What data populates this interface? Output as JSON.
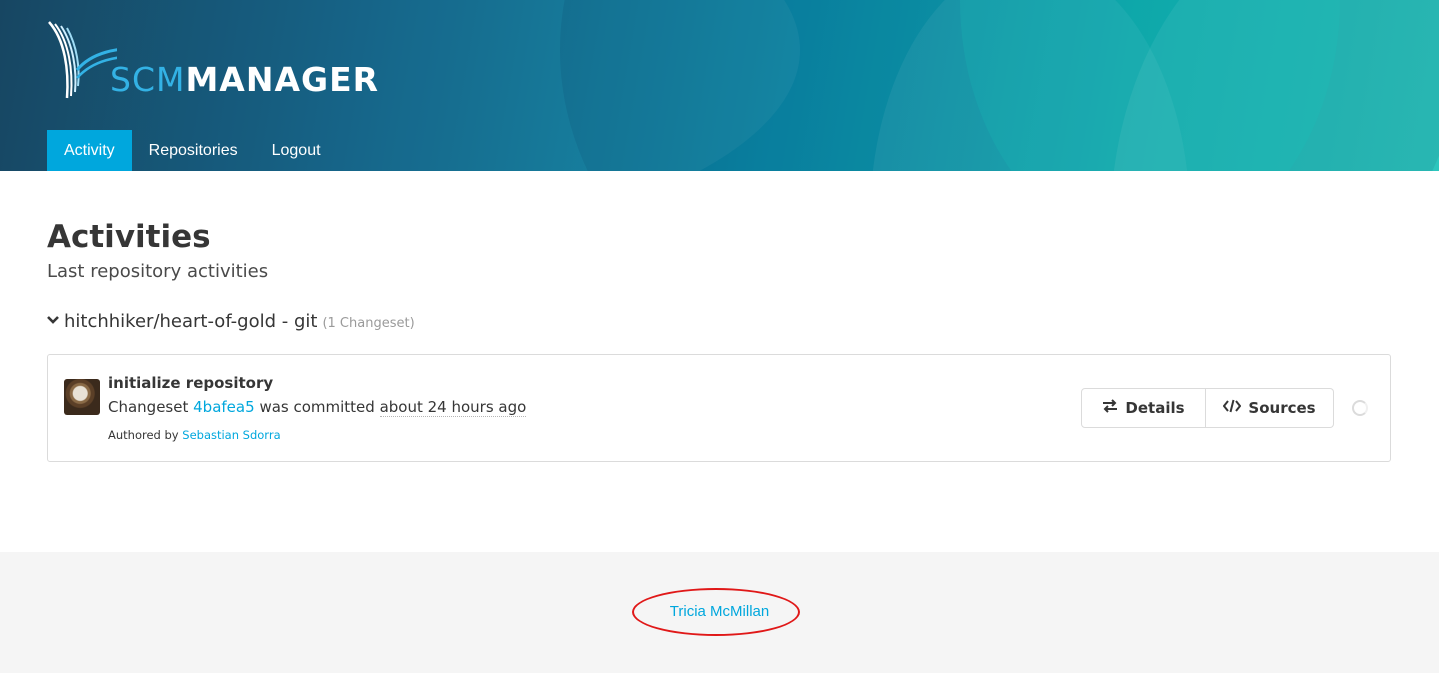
{
  "header": {
    "logo": {
      "text_light": "SCM",
      "text_bold": "MANAGER"
    },
    "nav": [
      {
        "label": "Activity",
        "active": true
      },
      {
        "label": "Repositories",
        "active": false
      },
      {
        "label": "Logout",
        "active": false
      }
    ]
  },
  "main": {
    "title": "Activities",
    "subtitle": "Last repository activities",
    "repo_group": {
      "name": "hitchhiker/heart-of-gold - git",
      "count": "(1 Changeset)",
      "changesets": [
        {
          "message": "initialize repository",
          "prefix": "Changeset",
          "hash": "4bafea5",
          "middle": "was committed",
          "time": "about 24 hours ago",
          "authored_by": "Authored by",
          "author": "Sebastian Sdorra",
          "buttons": {
            "details": "Details",
            "sources": "Sources"
          }
        }
      ]
    }
  },
  "footer": {
    "user": "Tricia McMillan"
  },
  "colors": {
    "accent": "#00a7dd",
    "nav_active": "#00a7dd",
    "highlight": "#e01818",
    "footer_bg": "#f5f5f5"
  },
  "icons": [
    "scm-manager-logo",
    "chevron-down-icon",
    "exchange-icon",
    "code-icon",
    "loading-spinner-icon"
  ]
}
